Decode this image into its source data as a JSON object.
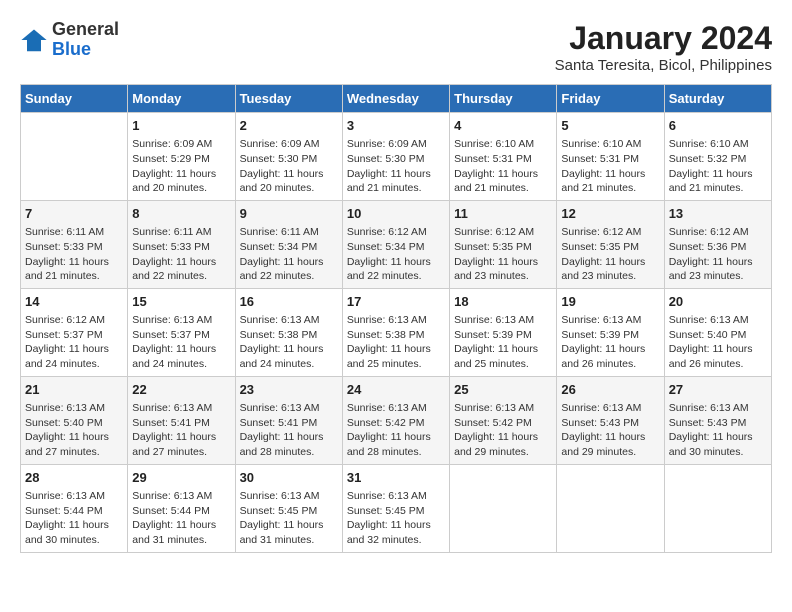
{
  "logo": {
    "general": "General",
    "blue": "Blue"
  },
  "title": "January 2024",
  "subtitle": "Santa Teresita, Bicol, Philippines",
  "days_of_week": [
    "Sunday",
    "Monday",
    "Tuesday",
    "Wednesday",
    "Thursday",
    "Friday",
    "Saturday"
  ],
  "weeks": [
    [
      {
        "day": "",
        "info": ""
      },
      {
        "day": "1",
        "info": "Sunrise: 6:09 AM\nSunset: 5:29 PM\nDaylight: 11 hours\nand 20 minutes."
      },
      {
        "day": "2",
        "info": "Sunrise: 6:09 AM\nSunset: 5:30 PM\nDaylight: 11 hours\nand 20 minutes."
      },
      {
        "day": "3",
        "info": "Sunrise: 6:09 AM\nSunset: 5:30 PM\nDaylight: 11 hours\nand 21 minutes."
      },
      {
        "day": "4",
        "info": "Sunrise: 6:10 AM\nSunset: 5:31 PM\nDaylight: 11 hours\nand 21 minutes."
      },
      {
        "day": "5",
        "info": "Sunrise: 6:10 AM\nSunset: 5:31 PM\nDaylight: 11 hours\nand 21 minutes."
      },
      {
        "day": "6",
        "info": "Sunrise: 6:10 AM\nSunset: 5:32 PM\nDaylight: 11 hours\nand 21 minutes."
      }
    ],
    [
      {
        "day": "7",
        "info": "Sunrise: 6:11 AM\nSunset: 5:33 PM\nDaylight: 11 hours\nand 21 minutes."
      },
      {
        "day": "8",
        "info": "Sunrise: 6:11 AM\nSunset: 5:33 PM\nDaylight: 11 hours\nand 22 minutes."
      },
      {
        "day": "9",
        "info": "Sunrise: 6:11 AM\nSunset: 5:34 PM\nDaylight: 11 hours\nand 22 minutes."
      },
      {
        "day": "10",
        "info": "Sunrise: 6:12 AM\nSunset: 5:34 PM\nDaylight: 11 hours\nand 22 minutes."
      },
      {
        "day": "11",
        "info": "Sunrise: 6:12 AM\nSunset: 5:35 PM\nDaylight: 11 hours\nand 23 minutes."
      },
      {
        "day": "12",
        "info": "Sunrise: 6:12 AM\nSunset: 5:35 PM\nDaylight: 11 hours\nand 23 minutes."
      },
      {
        "day": "13",
        "info": "Sunrise: 6:12 AM\nSunset: 5:36 PM\nDaylight: 11 hours\nand 23 minutes."
      }
    ],
    [
      {
        "day": "14",
        "info": "Sunrise: 6:12 AM\nSunset: 5:37 PM\nDaylight: 11 hours\nand 24 minutes."
      },
      {
        "day": "15",
        "info": "Sunrise: 6:13 AM\nSunset: 5:37 PM\nDaylight: 11 hours\nand 24 minutes."
      },
      {
        "day": "16",
        "info": "Sunrise: 6:13 AM\nSunset: 5:38 PM\nDaylight: 11 hours\nand 24 minutes."
      },
      {
        "day": "17",
        "info": "Sunrise: 6:13 AM\nSunset: 5:38 PM\nDaylight: 11 hours\nand 25 minutes."
      },
      {
        "day": "18",
        "info": "Sunrise: 6:13 AM\nSunset: 5:39 PM\nDaylight: 11 hours\nand 25 minutes."
      },
      {
        "day": "19",
        "info": "Sunrise: 6:13 AM\nSunset: 5:39 PM\nDaylight: 11 hours\nand 26 minutes."
      },
      {
        "day": "20",
        "info": "Sunrise: 6:13 AM\nSunset: 5:40 PM\nDaylight: 11 hours\nand 26 minutes."
      }
    ],
    [
      {
        "day": "21",
        "info": "Sunrise: 6:13 AM\nSunset: 5:40 PM\nDaylight: 11 hours\nand 27 minutes."
      },
      {
        "day": "22",
        "info": "Sunrise: 6:13 AM\nSunset: 5:41 PM\nDaylight: 11 hours\nand 27 minutes."
      },
      {
        "day": "23",
        "info": "Sunrise: 6:13 AM\nSunset: 5:41 PM\nDaylight: 11 hours\nand 28 minutes."
      },
      {
        "day": "24",
        "info": "Sunrise: 6:13 AM\nSunset: 5:42 PM\nDaylight: 11 hours\nand 28 minutes."
      },
      {
        "day": "25",
        "info": "Sunrise: 6:13 AM\nSunset: 5:42 PM\nDaylight: 11 hours\nand 29 minutes."
      },
      {
        "day": "26",
        "info": "Sunrise: 6:13 AM\nSunset: 5:43 PM\nDaylight: 11 hours\nand 29 minutes."
      },
      {
        "day": "27",
        "info": "Sunrise: 6:13 AM\nSunset: 5:43 PM\nDaylight: 11 hours\nand 30 minutes."
      }
    ],
    [
      {
        "day": "28",
        "info": "Sunrise: 6:13 AM\nSunset: 5:44 PM\nDaylight: 11 hours\nand 30 minutes."
      },
      {
        "day": "29",
        "info": "Sunrise: 6:13 AM\nSunset: 5:44 PM\nDaylight: 11 hours\nand 31 minutes."
      },
      {
        "day": "30",
        "info": "Sunrise: 6:13 AM\nSunset: 5:45 PM\nDaylight: 11 hours\nand 31 minutes."
      },
      {
        "day": "31",
        "info": "Sunrise: 6:13 AM\nSunset: 5:45 PM\nDaylight: 11 hours\nand 32 minutes."
      },
      {
        "day": "",
        "info": ""
      },
      {
        "day": "",
        "info": ""
      },
      {
        "day": "",
        "info": ""
      }
    ]
  ]
}
